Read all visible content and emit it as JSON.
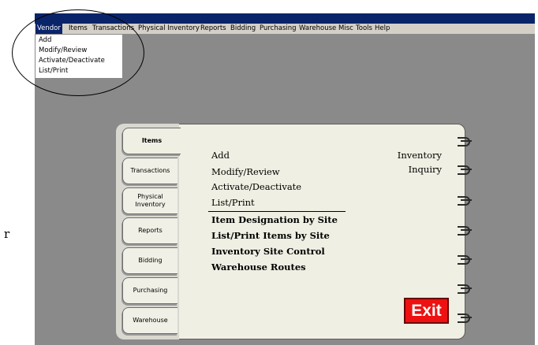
{
  "menu": {
    "items": [
      "Vendor",
      "Items",
      "Transactions",
      "Physical Inventory",
      "Reports",
      "Bidding",
      "Purchasing",
      "Warehouse",
      "Misc",
      "Tools",
      "Help"
    ],
    "active": "Vendor"
  },
  "vendor_dropdown": {
    "items": [
      "Add",
      "Modify/Review",
      "Activate/Deactivate",
      "List/Print"
    ]
  },
  "page_fragment": "r",
  "notebook": {
    "tabs": [
      "Items",
      "Transactions",
      "Physical Inventory",
      "Reports",
      "Bidding",
      "Purchasing",
      "Warehouse"
    ],
    "active_tab": "Items",
    "options_primary": [
      "Add",
      "Modify/Review",
      "Activate/Deactivate",
      "List/Print"
    ],
    "options_secondary": [
      "Item Designation by Site",
      "List/Print Items by Site",
      "Inventory Site Control",
      "Warehouse Routes"
    ],
    "inventory_inquiry": [
      "Inventory",
      "Inquiry"
    ],
    "exit_label": "Exit"
  },
  "colors": {
    "window_bg": "#8a8a8a",
    "titlebar": "#0a246a",
    "menu_bg": "#d4d0c8",
    "exit_red": "#ee1111",
    "notebook_bg": "#efefe3"
  }
}
